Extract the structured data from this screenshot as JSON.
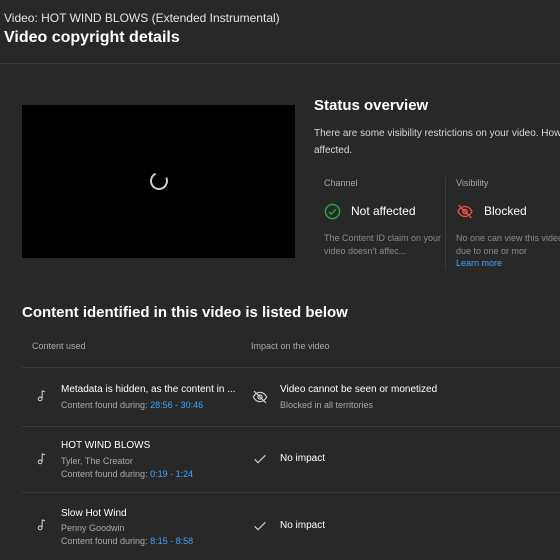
{
  "header": {
    "video_title": "Video: HOT WIND BLOWS (Extended Instrumental)",
    "page_title": "Video copyright details"
  },
  "status": {
    "title": "Status overview",
    "description": "There are some visibility restrictions on your video. How affected.",
    "channel": {
      "label": "Channel",
      "status": "Not affected",
      "note": "The Content ID claim on your video doesn't affec..."
    },
    "visibility": {
      "label": "Visibility",
      "status": "Blocked",
      "note": "No one can view this video due to one or mor",
      "link": "Learn more"
    }
  },
  "content": {
    "title": "Content identified in this video is listed below",
    "col_content": "Content used",
    "col_impact": "Impact on the video",
    "rows": [
      {
        "title": "Metadata is hidden, as the content in ...",
        "found_label": "Content found during:",
        "time": "28:56 - 30:46",
        "impact": "Video cannot be seen or monetized",
        "impact_sub": "Blocked in all territories"
      },
      {
        "title": "HOT WIND BLOWS",
        "artist": "Tyler, The Creator",
        "found_label": "Content found during:",
        "time": "0:19 - 1:24",
        "impact": "No impact"
      },
      {
        "title": "Slow Hot Wind",
        "artist": "Penny Goodwin",
        "found_label": "Content found during:",
        "time": "8:15 - 8:58",
        "impact": "No impact"
      }
    ]
  },
  "colors": {
    "background": "#282828",
    "link": "#3ea6ff",
    "success": "#2ba640",
    "danger": "#ff4e45"
  },
  "icons": [
    "loading-spinner",
    "check-circle-icon",
    "visibility-off-icon",
    "music-note-icon",
    "checkmark-icon"
  ]
}
